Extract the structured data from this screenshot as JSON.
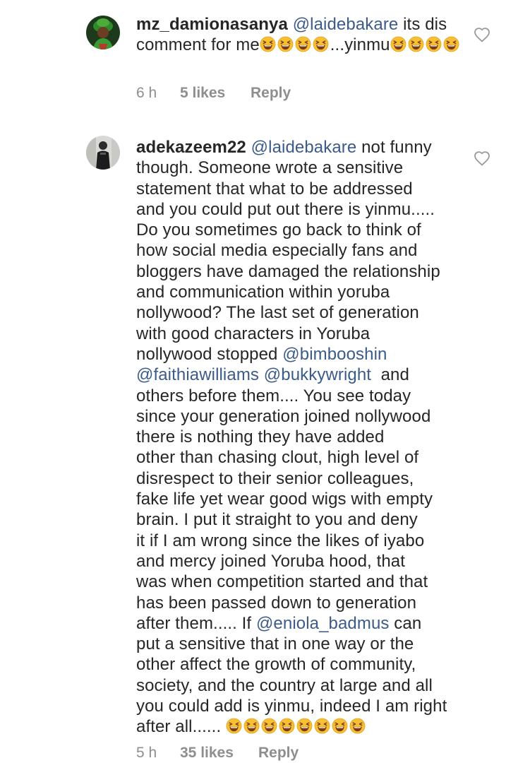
{
  "comments": [
    {
      "username": "mz_damionasanya",
      "avatar_icon": "profile-photo-woman-green-headwrap",
      "segments": [
        {
          "type": "mention",
          "text": "@laidebakare"
        },
        {
          "type": "text",
          "text": " its dis comment for me"
        },
        {
          "type": "emoji",
          "name": "grinning-squinting-face-emoji",
          "count": 4
        },
        {
          "type": "text",
          "text": "...yinmu"
        },
        {
          "type": "emoji",
          "name": "grinning-squinting-face-emoji",
          "count": 4
        }
      ],
      "time": "6 h",
      "likes": "5 likes",
      "reply_label": "Reply",
      "like_icon": "heart-outline-icon"
    },
    {
      "username": "adekazeem22",
      "avatar_icon": "profile-photo-man-dark-outfit",
      "lines": [
        "adekazeem22 @laidebakare not funny",
        "though. Someone wrote a sensitive",
        "statement that what to be addressed",
        "and you could put out there is yinmu.....",
        "Do you sometimes go back to think of",
        "how social media especially fans and",
        "bloggers have damaged the relationship",
        "and communication within yoruba",
        "nollywood? The last set of generation",
        "with good characters in Yoruba",
        "nollywood stopped @bimbooshin",
        "@faithiawilliams @bukkywright  and",
        "others before them.... You see today",
        "since your generation joined nollywood",
        "there is nothing they have added",
        "other than chasing clout, high level of",
        "disrespect to their senior colleagues,",
        "fake life yet wear good wigs with empty",
        "brain. I put it straight to you and deny",
        "it if I am wrong since the likes of iyabo",
        "and mercy joined Yoruba hood, that",
        "was when competition started and that",
        "has been passed down to generation",
        "after them..... If @eniola_badmus can",
        "put a sensitive that in one way or the",
        "other affect the growth of community,",
        "society, and the country at large and all",
        "you could add is yinmu, indeed I am right",
        "after all...... "
      ],
      "mentions": [
        "@laidebakare",
        "@bimbooshin",
        "@faithiawilliams",
        "@bukkywright",
        "@eniola_badmus"
      ],
      "trailing_emoji": {
        "name": "grinning-squinting-face-emoji",
        "count": 8
      },
      "time": "5 h",
      "likes": "35 likes",
      "reply_label": "Reply",
      "like_icon": "heart-outline-icon"
    }
  ],
  "colors": {
    "text": "#262626",
    "mention": "#3b5b8a",
    "meta": "#8e8e8e",
    "emoji_face": "#f7c034",
    "emoji_mouth": "#7a3b12"
  }
}
